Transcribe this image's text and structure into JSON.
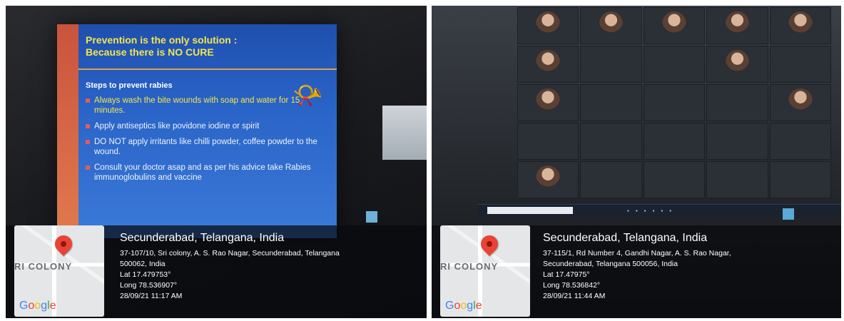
{
  "photos": [
    {
      "slide": {
        "title_line1": "Prevention is the only solution :",
        "title_line2": "Because there is NO CURE",
        "subtitle": "Steps to prevent rabies",
        "bullets": [
          "Always wash the  bite wounds with soap and water for 15 minutes.",
          "Apply antiseptics like povidone iodine or spirit",
          "DO NOT apply irritants  like chilli powder, coffee powder  to the wound.",
          "Consult your doctor asap and as per his advice take Rabies immunoglobulins and vaccine"
        ]
      },
      "geotag": {
        "city": "Secunderabad, Telangana, India",
        "address_line1": "37-107/10, Sri colony, A. S. Rao Nagar, Secunderabad, Telangana",
        "address_line2": "500062, India",
        "lat": "Lat 17.479753°",
        "long": "Long 78.536907°",
        "datetime": "28/09/21 11:17 AM",
        "map_label": "RI COLONY"
      }
    },
    {
      "geotag": {
        "city": "Secunderabad, Telangana, India",
        "address_line1": "37-115/1, Rd Number 4, Gandhi Nagar, A. S. Rao Nagar,",
        "address_line2": "Secunderabad, Telangana 500056, India",
        "lat": "Lat 17.47975°",
        "long": "Long 78.536842°",
        "datetime": "28/09/21 11:44 AM",
        "map_label": "RI COLONY"
      }
    }
  ],
  "brand": {
    "google_letters": [
      "G",
      "o",
      "o",
      "g",
      "l",
      "e"
    ]
  },
  "icons": [
    "map-pin-icon",
    "horn-icon",
    "search-icon"
  ],
  "colors": {
    "slide_bg": "#2a64c8",
    "slide_title": "#f4e64a",
    "pin": "#ea4335"
  }
}
